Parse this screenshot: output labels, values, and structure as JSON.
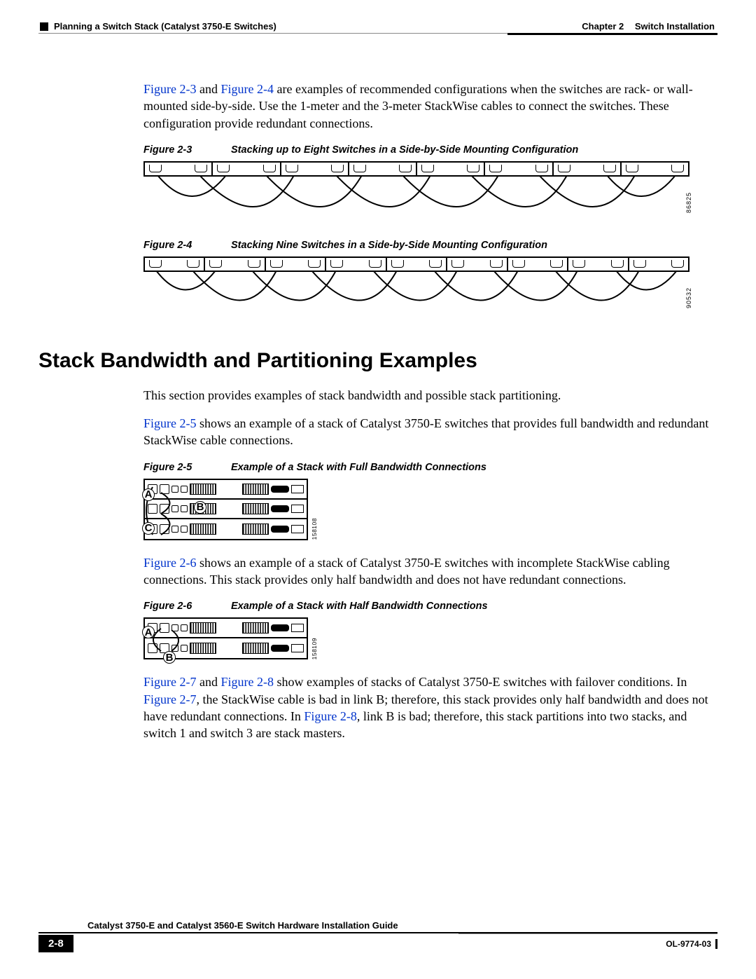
{
  "header": {
    "chapter_label": "Chapter 2",
    "chapter_title": "Switch Installation",
    "breadcrumb": "Planning a Switch Stack (Catalyst 3750-E Switches)"
  },
  "intro": {
    "ref1": "Figure 2-3",
    "joiner1": " and ",
    "ref2": "Figure 2-4",
    "rest": " are examples of recommended configurations when the switches are rack- or wall-mounted side-by-side. Use the 1-meter and the 3-meter StackWise cables to connect the switches. These configuration provide redundant connections."
  },
  "fig23": {
    "id": "Figure 2-3",
    "title": "Stacking up to Eight Switches in a Side-by-Side Mounting Configuration",
    "sidenum": "86825"
  },
  "fig24": {
    "id": "Figure 2-4",
    "title": "Stacking Nine Switches in a Side-by-Side Mounting Configuration",
    "sidenum": "90532"
  },
  "section_heading": "Stack Bandwidth and Partitioning Examples",
  "p_intro2": "This section provides examples of stack bandwidth and possible stack partitioning.",
  "p25": {
    "ref": "Figure 2-5",
    "rest": " shows an example of a stack of Catalyst 3750-E switches that provides full bandwidth and redundant StackWise cable connections."
  },
  "fig25": {
    "id": "Figure 2-5",
    "title": "Example of a Stack with Full Bandwidth Connections",
    "labelA": "A",
    "labelB": "B",
    "labelC": "C",
    "sidenum": "158108"
  },
  "p26": {
    "ref": "Figure 2-6",
    "rest": " shows an example of a stack of Catalyst 3750-E switches with incomplete StackWise cabling connections. This stack provides only half bandwidth and does not have redundant connections."
  },
  "fig26": {
    "id": "Figure 2-6",
    "title": "Example of a Stack with Half Bandwidth Connections",
    "labelA": "A",
    "labelB": "B",
    "sidenum": "158109"
  },
  "p78": {
    "ref1": "Figure 2-7",
    "joiner1": " and ",
    "ref2": "Figure 2-8",
    "mid1": " show examples of stacks of Catalyst 3750-E switches with failover conditions. In ",
    "ref3": "Figure 2-7",
    "mid2": ", the StackWise cable is bad in link B; therefore, this stack provides only half bandwidth and does not have redundant connections. In ",
    "ref4": "Figure 2-8",
    "mid3": ", link B is bad; therefore, this stack partitions into two stacks, and switch 1 and switch 3 are stack masters."
  },
  "footer": {
    "book": "Catalyst 3750-E and Catalyst 3560-E Switch Hardware Installation Guide",
    "page": "2-8",
    "docid": "OL-9774-03"
  }
}
